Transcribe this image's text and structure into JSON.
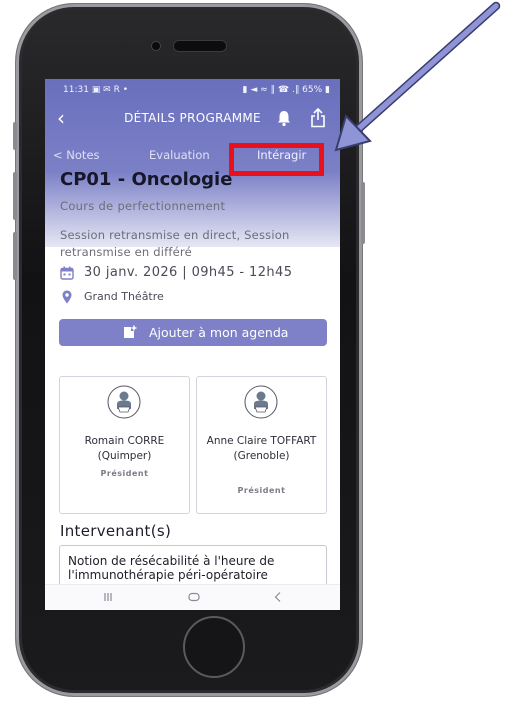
{
  "status_bar": {
    "time": "11:31",
    "left_indicators": "▣ ✉ R •",
    "right_indicators": "▮ ◄ ≈ ∥ ☎ .∥ 65% ▮"
  },
  "navbar": {
    "title": "DÉTAILS PROGRAMME",
    "back_icon": "chevron-left-icon",
    "bell_icon": "bell-icon",
    "share_icon": "share-icon"
  },
  "tabs": [
    {
      "label": "< Notes"
    },
    {
      "label": "Evaluation"
    },
    {
      "label": "Intéragir"
    }
  ],
  "session": {
    "title": "CP01 - Oncologie",
    "type": "Cours de perfectionnement",
    "broadcast": "Session retransmise en direct, Session retransmise en différé",
    "datetime": "30 janv. 2026 | 09h45 - 12h45",
    "location": "Grand Théâtre"
  },
  "agenda_button": {
    "label": "Ajouter à mon agenda"
  },
  "chairs": [
    {
      "name": "Romain CORRE (Quimper)",
      "role": "Président"
    },
    {
      "name": "Anne Claire TOFFART (Grenoble)",
      "role": "Président"
    }
  ],
  "speakers_section": {
    "title": "Intervenant(s)"
  },
  "talks": [
    {
      "title": "Notion de résécabilité à l'heure de l'immunothérapie péri-opératoire"
    }
  ],
  "colors": {
    "header": "#6a6fbd",
    "button": "#7e81c7",
    "highlight": "#e8101a",
    "arrow": "#8f94d6"
  }
}
